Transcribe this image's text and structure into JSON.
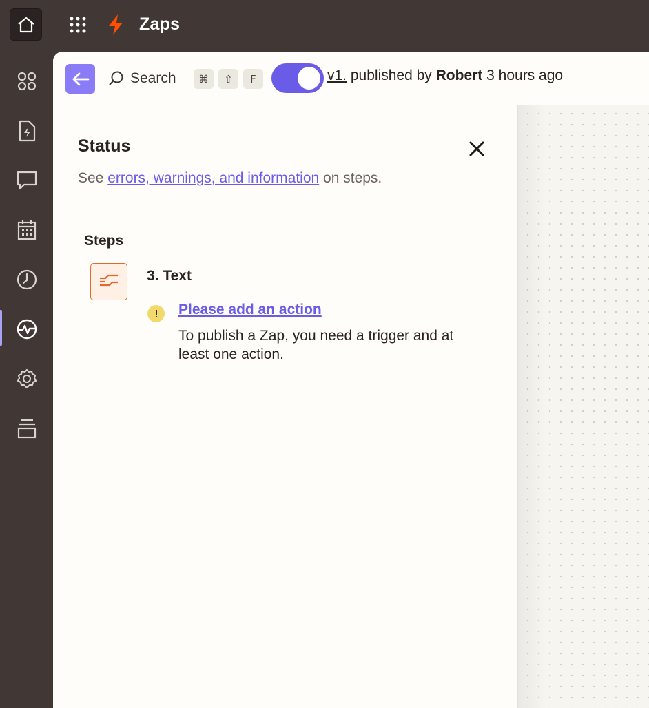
{
  "app": {
    "title": "Zaps"
  },
  "toolbar": {
    "search_label": "Search",
    "shortcut_keys": [
      "⌘",
      "⇧",
      "F"
    ],
    "version_link": "v1.",
    "published_by": "published by",
    "author": "Robert",
    "published_time": "3 hours ago",
    "toggle_on": true
  },
  "status_panel": {
    "title": "Status",
    "subtitle_prefix": "See",
    "subtitle_link": "errors, warnings, and information",
    "subtitle_suffix": "on steps.",
    "steps_heading": "Steps",
    "steps": [
      {
        "name": "3. Text",
        "warning_title": "Please add an action",
        "warning_body": "To publish a Zap, you need a trigger and at least one action."
      }
    ]
  },
  "sidebar": {
    "items": [
      {
        "icon": "templates-icon"
      },
      {
        "icon": "zap-file-icon"
      },
      {
        "icon": "chat-icon"
      },
      {
        "icon": "calendar-icon"
      },
      {
        "icon": "history-icon"
      },
      {
        "icon": "activity-icon",
        "active": true
      },
      {
        "icon": "settings-icon"
      },
      {
        "icon": "versions-icon"
      }
    ]
  },
  "colors": {
    "chrome": "#413735",
    "accent": "#6b5ce7",
    "brand_bolt": "#ff4f00",
    "warning": "#f2d96b",
    "step_accent": "#e36a2e"
  }
}
